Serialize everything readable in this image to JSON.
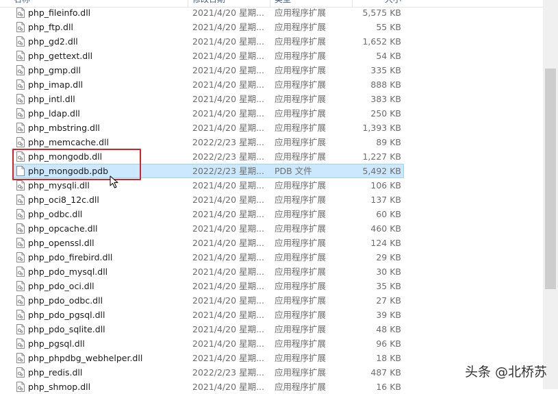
{
  "header": {
    "name": "名称",
    "date": "修改日期",
    "type": "类型",
    "size": "大小"
  },
  "files": [
    {
      "name": "php_fileinfo.dll",
      "date": "2021/4/20 星期...",
      "type": "应用程序扩展",
      "size": "5,575 KB"
    },
    {
      "name": "php_ftp.dll",
      "date": "2021/4/20 星期...",
      "type": "应用程序扩展",
      "size": "55 KB"
    },
    {
      "name": "php_gd2.dll",
      "date": "2021/4/20 星期...",
      "type": "应用程序扩展",
      "size": "1,652 KB"
    },
    {
      "name": "php_gettext.dll",
      "date": "2021/4/20 星期...",
      "type": "应用程序扩展",
      "size": "54 KB"
    },
    {
      "name": "php_gmp.dll",
      "date": "2021/4/20 星期...",
      "type": "应用程序扩展",
      "size": "335 KB"
    },
    {
      "name": "php_imap.dll",
      "date": "2021/4/20 星期...",
      "type": "应用程序扩展",
      "size": "888 KB"
    },
    {
      "name": "php_intl.dll",
      "date": "2021/4/20 星期...",
      "type": "应用程序扩展",
      "size": "383 KB"
    },
    {
      "name": "php_ldap.dll",
      "date": "2021/4/20 星期...",
      "type": "应用程序扩展",
      "size": "250 KB"
    },
    {
      "name": "php_mbstring.dll",
      "date": "2021/4/20 星期...",
      "type": "应用程序扩展",
      "size": "1,393 KB"
    },
    {
      "name": "php_memcache.dll",
      "date": "2022/2/23 星期...",
      "type": "应用程序扩展",
      "size": "89 KB"
    },
    {
      "name": "php_mongodb.dll",
      "date": "2022/2/23 星期...",
      "type": "应用程序扩展",
      "size": "1,227 KB"
    },
    {
      "name": "php_mongodb.pdb",
      "date": "2022/2/23 星期...",
      "type": "PDB 文件",
      "size": "5,492 KB",
      "selected": true
    },
    {
      "name": "php_mysqli.dll",
      "date": "2021/4/20 星期...",
      "type": "应用程序扩展",
      "size": "106 KB"
    },
    {
      "name": "php_oci8_12c.dll",
      "date": "2021/4/20 星期...",
      "type": "应用程序扩展",
      "size": "137 KB"
    },
    {
      "name": "php_odbc.dll",
      "date": "2021/4/20 星期...",
      "type": "应用程序扩展",
      "size": "60 KB"
    },
    {
      "name": "php_opcache.dll",
      "date": "2021/4/20 星期...",
      "type": "应用程序扩展",
      "size": "460 KB"
    },
    {
      "name": "php_openssl.dll",
      "date": "2021/4/20 星期...",
      "type": "应用程序扩展",
      "size": "124 KB"
    },
    {
      "name": "php_pdo_firebird.dll",
      "date": "2021/4/20 星期...",
      "type": "应用程序扩展",
      "size": "29 KB"
    },
    {
      "name": "php_pdo_mysql.dll",
      "date": "2021/4/20 星期...",
      "type": "应用程序扩展",
      "size": "30 KB"
    },
    {
      "name": "php_pdo_oci.dll",
      "date": "2021/4/20 星期...",
      "type": "应用程序扩展",
      "size": "35 KB"
    },
    {
      "name": "php_pdo_odbc.dll",
      "date": "2021/4/20 星期...",
      "type": "应用程序扩展",
      "size": "27 KB"
    },
    {
      "name": "php_pdo_pgsql.dll",
      "date": "2021/4/20 星期...",
      "type": "应用程序扩展",
      "size": "39 KB"
    },
    {
      "name": "php_pdo_sqlite.dll",
      "date": "2021/4/20 星期...",
      "type": "应用程序扩展",
      "size": "48 KB"
    },
    {
      "name": "php_pgsql.dll",
      "date": "2021/4/20 星期...",
      "type": "应用程序扩展",
      "size": "96 KB"
    },
    {
      "name": "php_phpdbg_webhelper.dll",
      "date": "2021/4/20 星期...",
      "type": "应用程序扩展",
      "size": "18 KB"
    },
    {
      "name": "php_redis.dll",
      "date": "2022/2/23 星期...",
      "type": "应用程序扩展",
      "size": "487 KB"
    },
    {
      "name": "php_shmop.dll",
      "date": "2021/4/20 星期...",
      "type": "应用程序扩展",
      "size": "16 KB"
    }
  ],
  "watermark": "头条 @北桥苏",
  "colors": {
    "selection_bg": "#cce8ff",
    "selection_border": "#99d1ff",
    "annotation_box": "#d2232a",
    "scrollbar_thumb": "#cdcdcd"
  },
  "icons": {
    "dll": "dll-file-icon",
    "pdb": "generic-file-icon",
    "cursor": "mouse-pointer-icon"
  }
}
